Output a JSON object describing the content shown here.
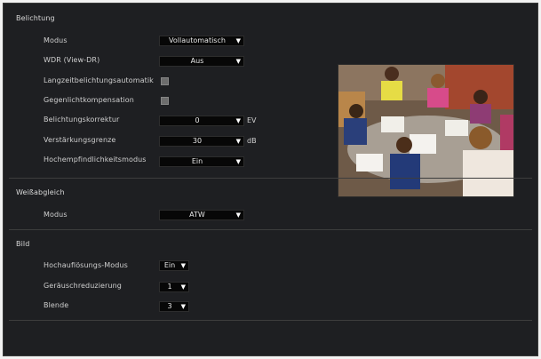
{
  "belichtung": {
    "title": "Belichtung",
    "modus_label": "Modus",
    "modus_value": "Vollautomatisch",
    "wdr_label": "WDR (View-DR)",
    "wdr_value": "Aus",
    "langzeit_label": "Langzeitbelichtungsautomatik",
    "gegenlicht_label": "Gegenlichtkompensation",
    "korrektur_label": "Belichtungskorrektur",
    "korrektur_value": "0",
    "korrektur_unit": "EV",
    "grenze_label": "Verstärkungsgrenze",
    "grenze_value": "30",
    "grenze_unit": "dB",
    "hochempf_label": "Hochempfindlichkeitsmodus",
    "hochempf_value": "Ein"
  },
  "weissabgleich": {
    "title": "Weißabgleich",
    "modus_label": "Modus",
    "modus_value": "ATW"
  },
  "bild": {
    "title": "Bild",
    "hochaufl_label": "Hochauflösungs-Modus",
    "hochaufl_value": "Ein",
    "rausch_label": "Geräuschreduzierung",
    "rausch_value": "1",
    "blende_label": "Blende",
    "blende_value": "3"
  },
  "icons": {
    "dropdown": "chevron-down-icon"
  },
  "colors": {
    "panel_bg": "#1e1f22",
    "select_bg": "#070707",
    "text": "#cfcfcf"
  }
}
